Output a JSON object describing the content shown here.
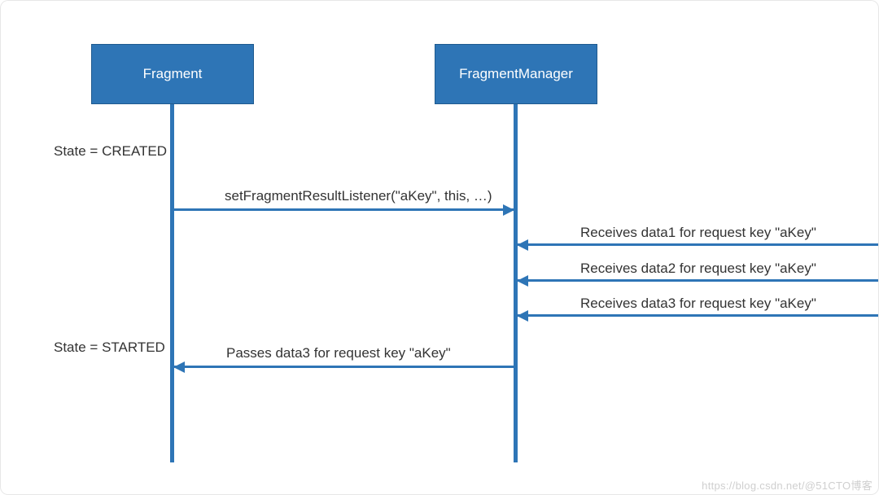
{
  "participants": {
    "fragment": "Fragment",
    "fragment_manager": "FragmentManager"
  },
  "states": {
    "created": "State = CREATED",
    "started": "State = STARTED"
  },
  "messages": {
    "set_listener": "setFragmentResultListener(\"aKey\", this, …)",
    "receive_data1": "Receives data1 for request key \"aKey\"",
    "receive_data2": "Receives data2 for request key \"aKey\"",
    "receive_data3": "Receives data3 for request key \"aKey\"",
    "pass_data3": "Passes data3 for request key \"aKey\""
  },
  "colors": {
    "box_fill": "#2e75b6",
    "line": "#2e75b6"
  },
  "watermark": "https://blog.csdn.net/@51CTO博客"
}
